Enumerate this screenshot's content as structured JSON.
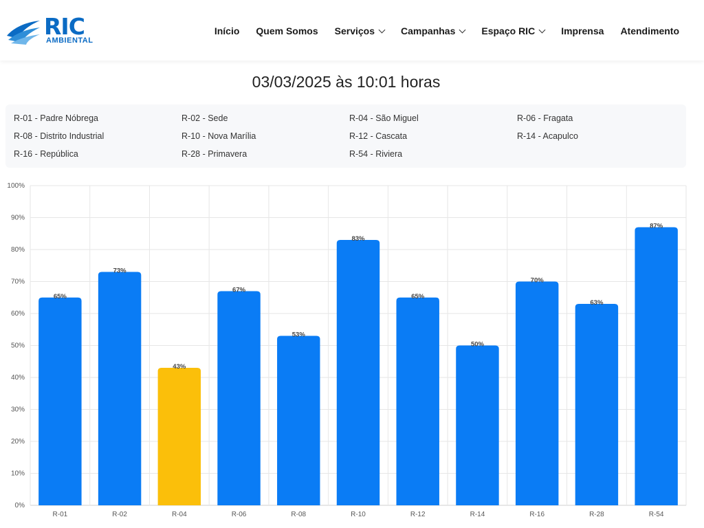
{
  "header": {
    "logo_text": "RIC",
    "logo_subtext": "AMBIENTAL",
    "nav": [
      {
        "label": "Início",
        "dropdown": false
      },
      {
        "label": "Quem Somos",
        "dropdown": false
      },
      {
        "label": "Serviços",
        "dropdown": true
      },
      {
        "label": "Campanhas",
        "dropdown": true
      },
      {
        "label": "Espaço RIC",
        "dropdown": true
      },
      {
        "label": "Imprensa",
        "dropdown": false
      },
      {
        "label": "Atendimento",
        "dropdown": false
      }
    ]
  },
  "title": "03/03/2025 às 10:01 horas",
  "legend": [
    "R-01 - Padre Nóbrega",
    "R-02 - Sede",
    "R-04 - São Miguel",
    "R-06 - Fragata",
    "R-08 - Distrito Industrial",
    "R-10 - Nova Marília",
    "R-12 - Cascata",
    "R-14 - Acapulco",
    "R-16 - República",
    "R-28 - Primavera",
    "R-54 - Riviera"
  ],
  "chart_data": {
    "type": "bar",
    "categories": [
      "R-01",
      "R-02",
      "R-04",
      "R-06",
      "R-08",
      "R-10",
      "R-12",
      "R-14",
      "R-16",
      "R-28",
      "R-54"
    ],
    "values": [
      65,
      73,
      43,
      67,
      53,
      83,
      65,
      50,
      70,
      63,
      87
    ],
    "data_labels": [
      "65%",
      "73%",
      "43%",
      "67%",
      "53%",
      "83%",
      "65%",
      "50%",
      "70%",
      "63%",
      "87%"
    ],
    "bar_colors": [
      "#0a7cf5",
      "#0a7cf5",
      "#fbbf0a",
      "#0a7cf5",
      "#0a7cf5",
      "#0a7cf5",
      "#0a7cf5",
      "#0a7cf5",
      "#0a7cf5",
      "#0a7cf5",
      "#0a7cf5"
    ],
    "y_ticks": [
      "0%",
      "10%",
      "20%",
      "30%",
      "40%",
      "50%",
      "60%",
      "70%",
      "80%",
      "90%",
      "100%"
    ],
    "ylim": [
      0,
      100
    ],
    "grid": true
  }
}
